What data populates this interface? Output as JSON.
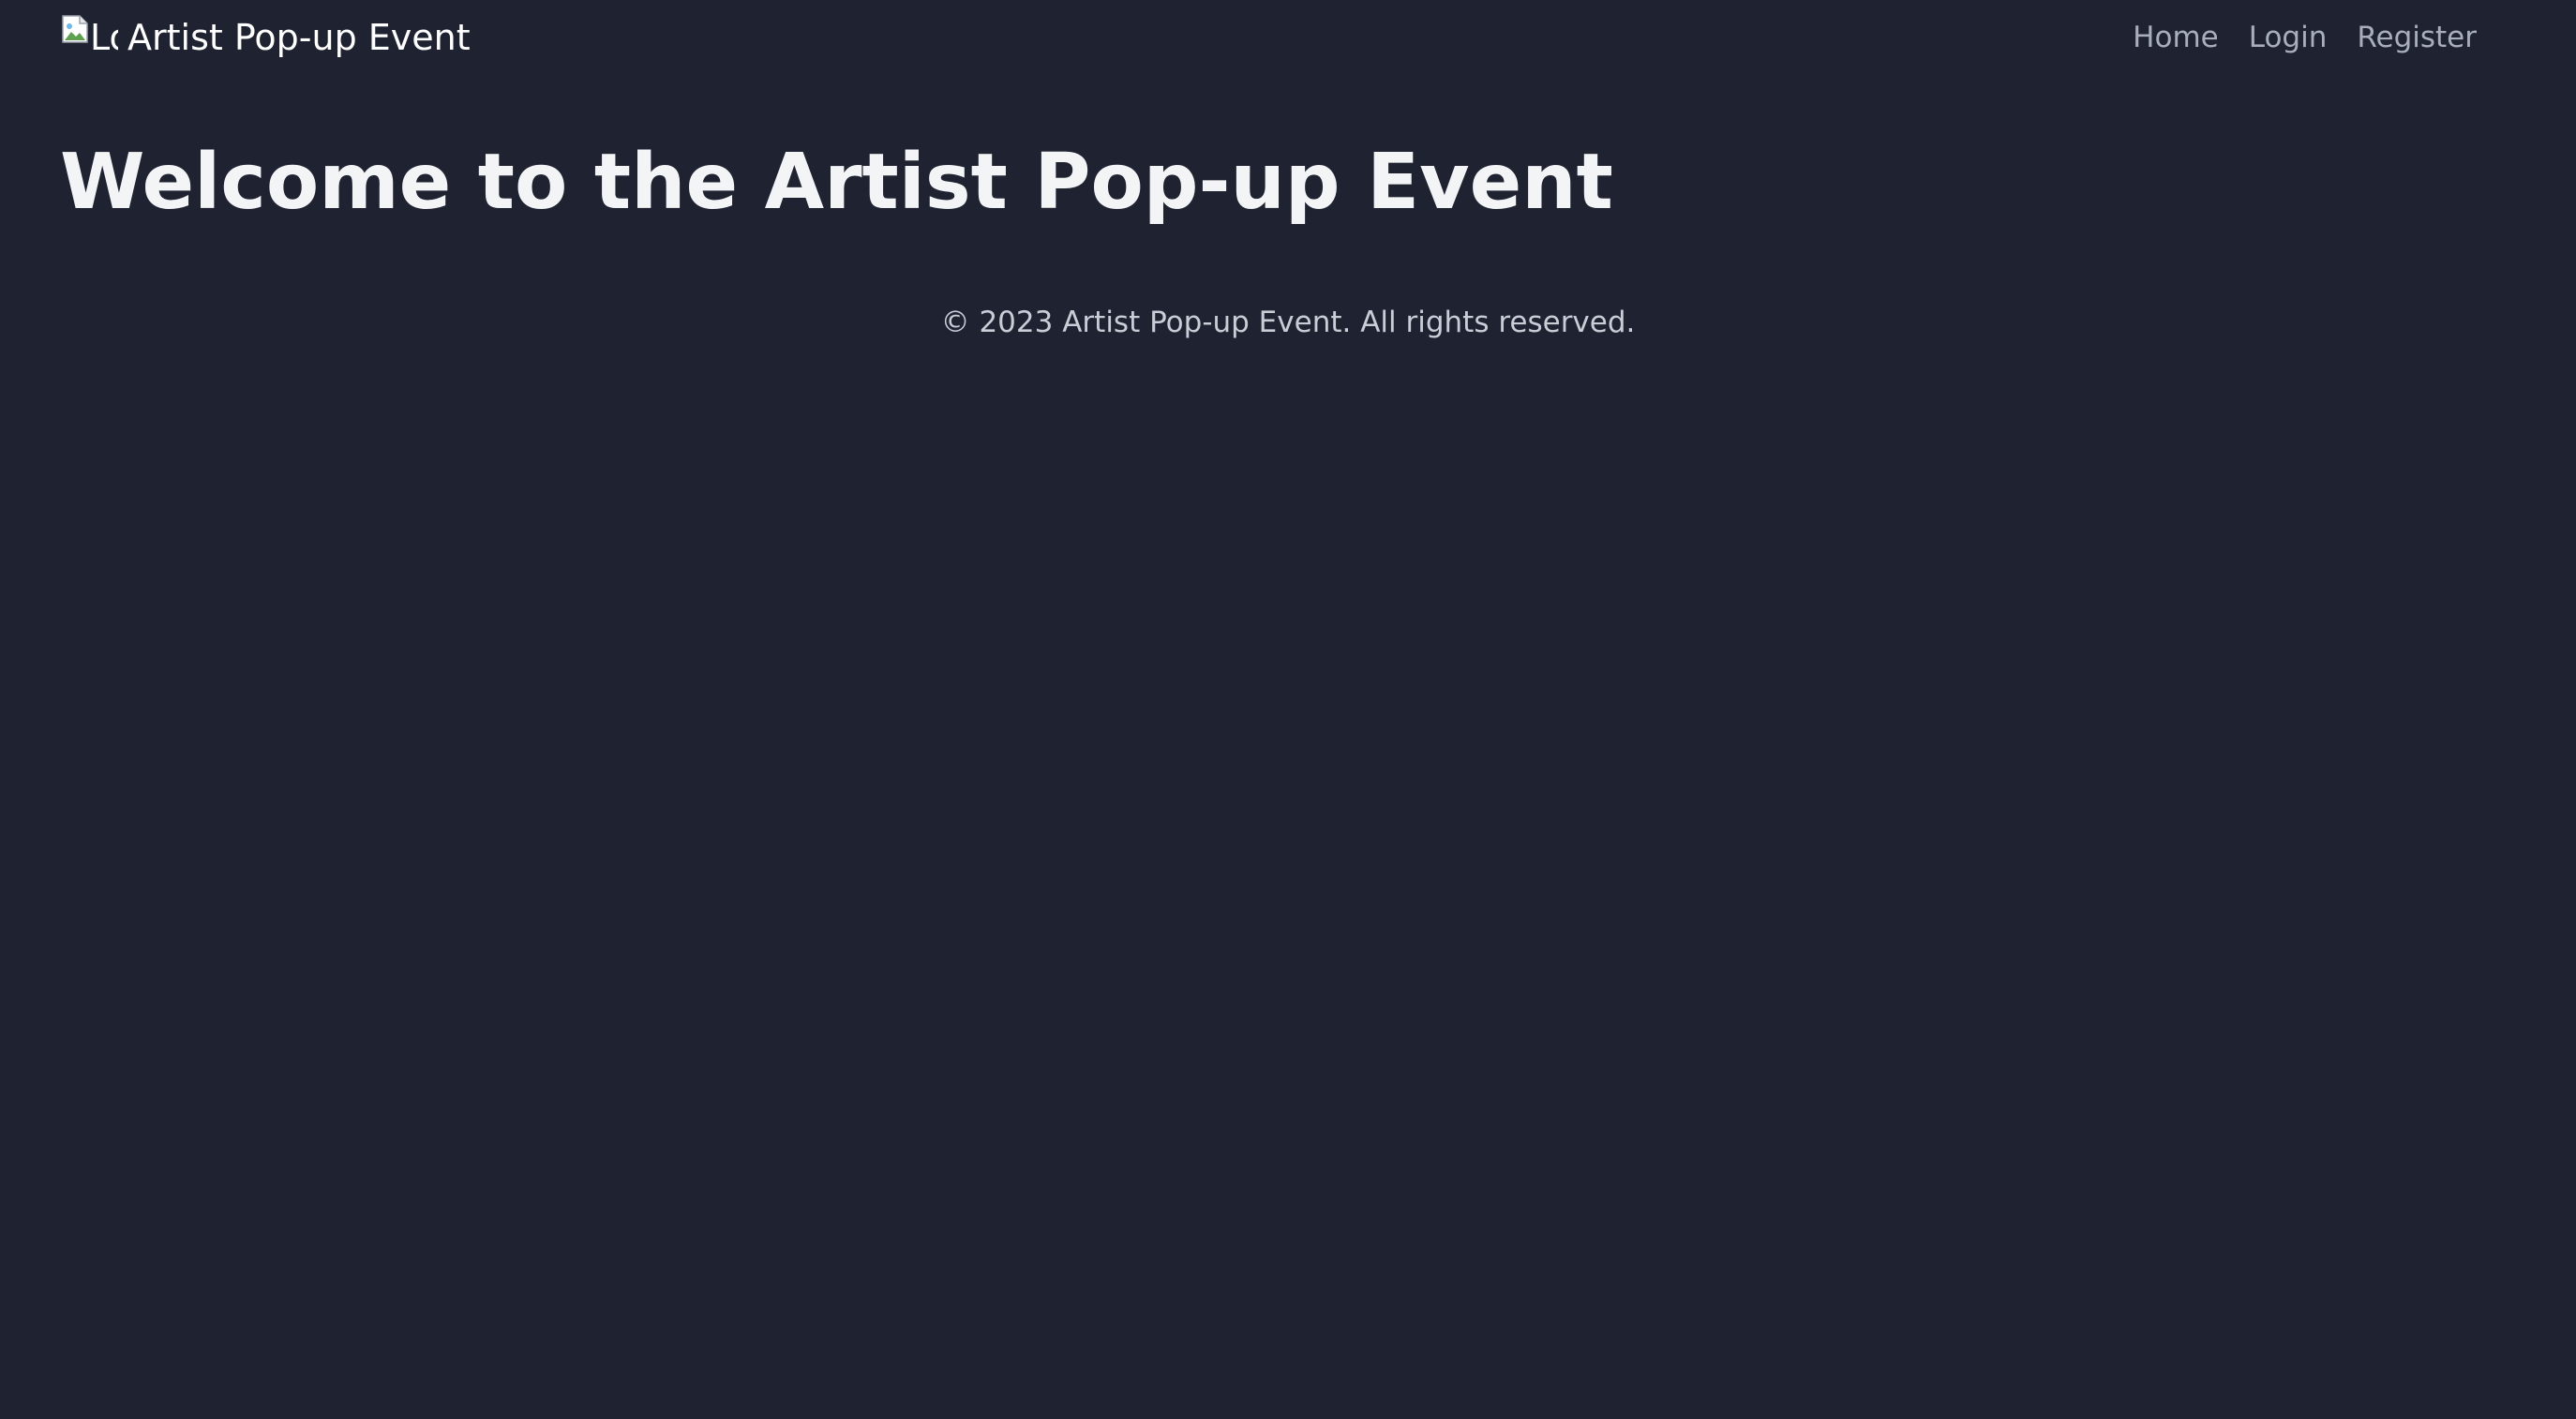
{
  "header": {
    "logo_alt": "Logo",
    "brand_title": "Artist Pop-up Event",
    "nav": [
      {
        "label": "Home"
      },
      {
        "label": "Login"
      },
      {
        "label": "Register"
      }
    ]
  },
  "main": {
    "heading": "Welcome to the Artist Pop-up Event"
  },
  "footer": {
    "copyright": "© 2023 Artist Pop-up Event. All rights reserved."
  },
  "colors": {
    "background": "#1e2231",
    "nav_link": "#a9aebb",
    "heading": "#f3f4f6",
    "footer_text": "#c9cdd6"
  },
  "icons": {
    "logo": "broken-image-icon"
  }
}
